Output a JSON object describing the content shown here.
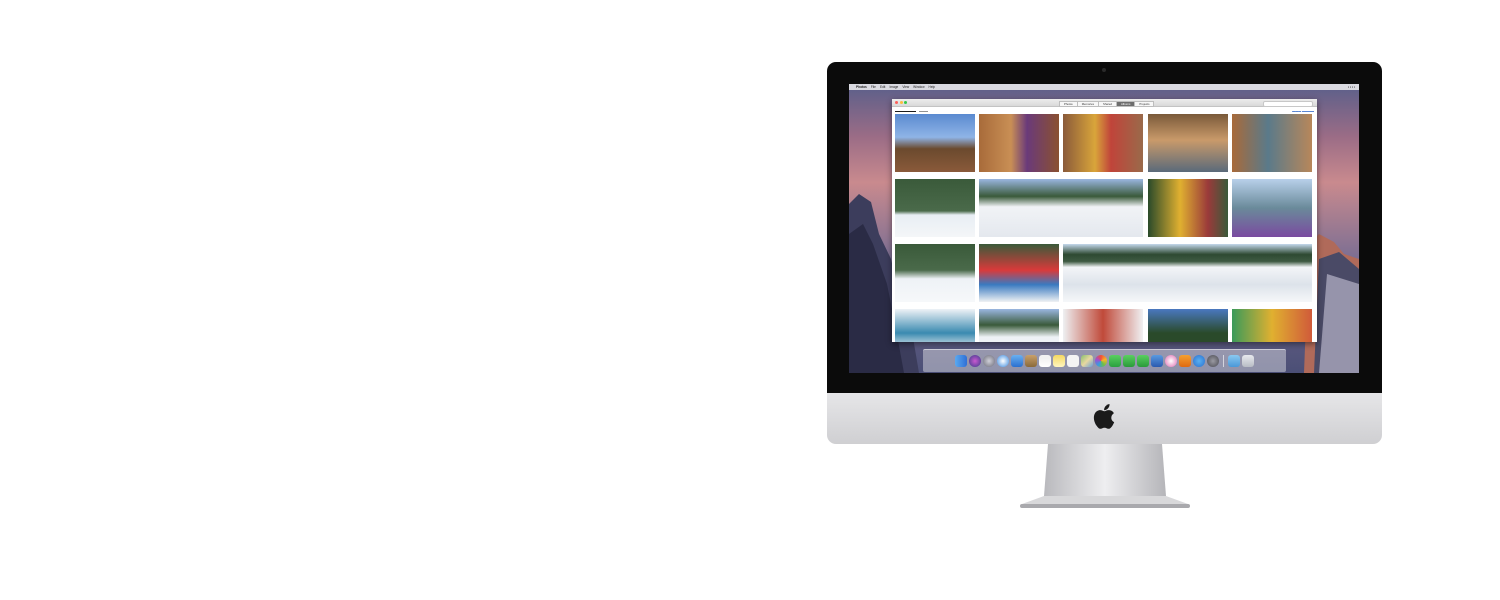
{
  "menubar": {
    "apple": "",
    "app_name": "Photos",
    "menus": [
      "File",
      "Edit",
      "Image",
      "View",
      "Window",
      "Help"
    ]
  },
  "photos_window": {
    "tabs": [
      {
        "label": "Photos",
        "active": false
      },
      {
        "label": "Memories",
        "active": false
      },
      {
        "label": "Shared",
        "active": false
      },
      {
        "label": "Albums",
        "active": true
      },
      {
        "label": "Projects",
        "active": false
      }
    ]
  },
  "colors": {
    "bezel": "#0b0b0b",
    "chin": "#d9d9dc",
    "wallpaper_top": "#5a5f8a",
    "wallpaper_mid": "#c98a8e",
    "active_tab": "#6d6d6d"
  },
  "dock_icons": [
    "finder-icon",
    "siri-icon",
    "launchpad-icon",
    "safari-icon",
    "mail-icon",
    "contacts-icon",
    "calendar-icon",
    "notes-icon",
    "reminders-icon",
    "maps-icon",
    "photos-icon",
    "messages-icon",
    "facetime-icon",
    "numbers-icon",
    "keynote-icon",
    "itunes-icon",
    "ibooks-icon",
    "appstore-icon",
    "system-preferences-icon",
    "downloads-folder-icon",
    "trash-icon"
  ]
}
